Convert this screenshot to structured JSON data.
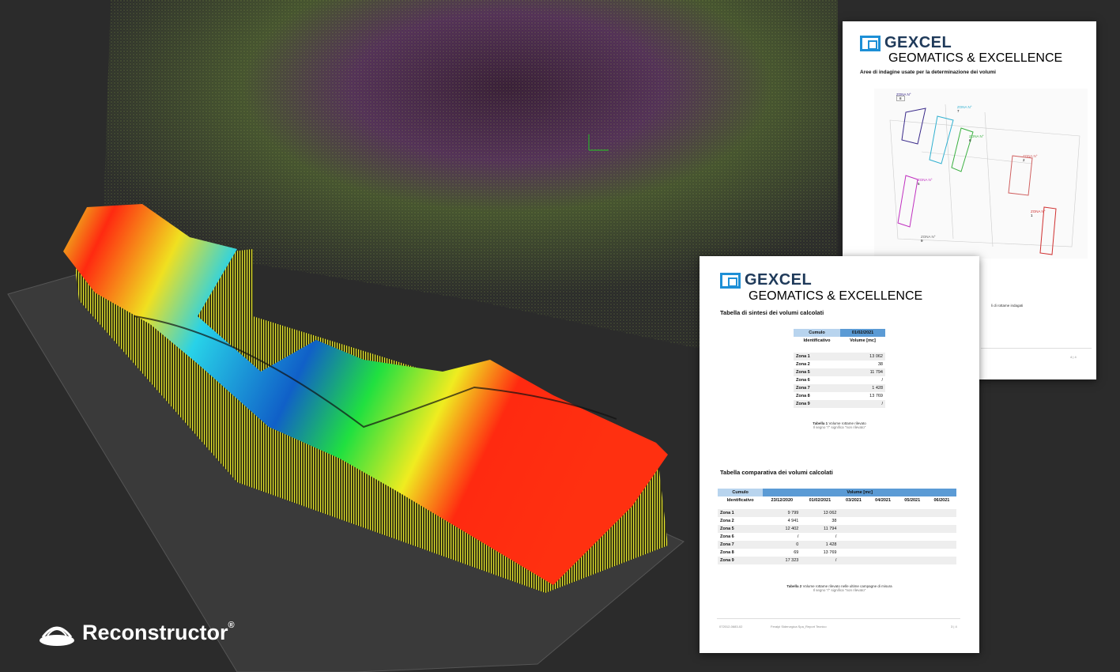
{
  "brand": {
    "name": "Reconstructor",
    "reg": "®"
  },
  "doc_back": {
    "logo": "GEXCEL",
    "logo_sub": "GEOMATICS & EXCELLENCE",
    "title": "Aree di indagine usate per la determinazione dei volumi",
    "zones": [
      {
        "label": "ZONA N°",
        "num": "8"
      },
      {
        "label": "ZONA N°",
        "num": "7"
      },
      {
        "label": "ZONA N°",
        "num": "6"
      },
      {
        "label": "ZONA N°",
        "num": "2"
      },
      {
        "label": "ZONA N°",
        "num": "5"
      },
      {
        "label": "ZONA N°",
        "num": "1"
      },
      {
        "label": "ZONA N°",
        "num": "9"
      }
    ],
    "caption": "li di rottame indagati",
    "page": "4 | 4"
  },
  "doc_front": {
    "logo": "GEXCEL",
    "logo_sub": "GEOMATICS & EXCELLENCE",
    "t1_title": "Tabella di sintesi dei volumi calcolati",
    "t1": {
      "h_cumulo": "Cumulo",
      "h_date": "01/02/2021",
      "h_ident": "Identificativo",
      "h_vol": "Volume [mc]",
      "rows": [
        {
          "zona": "Zona 1",
          "val": "13 062"
        },
        {
          "zona": "Zona 2",
          "val": "38"
        },
        {
          "zona": "Zona 5",
          "val": "11 794"
        },
        {
          "zona": "Zona 6",
          "val": "/"
        },
        {
          "zona": "Zona 7",
          "val": "1 428"
        },
        {
          "zona": "Zona 8",
          "val": "13 769"
        },
        {
          "zona": "Zona 9",
          "val": "/"
        }
      ],
      "cap_bold": "Tabella 1",
      "cap": "Volume rottame rilevato",
      "cap2": "Il segno \"/\" significa \"non rilevato\""
    },
    "t2_title": "Tabella comparativa dei volumi calcolati",
    "t2": {
      "h_cumulo": "Cumulo",
      "h_vol": "Volume [mc]",
      "h_ident": "Identificativo",
      "dates": [
        "23/12/2020",
        "01/02/2021",
        "03/2021",
        "04/2021",
        "05/2021",
        "06/2021"
      ],
      "rows": [
        {
          "zona": "Zona 1",
          "v1": "9 799",
          "v2": "13 062"
        },
        {
          "zona": "Zona 2",
          "v1": "4 941",
          "v2": "38"
        },
        {
          "zona": "Zona 5",
          "v1": "12 402",
          "v2": "11 794"
        },
        {
          "zona": "Zona 6",
          "v1": "/",
          "v2": "/"
        },
        {
          "zona": "Zona 7",
          "v1": "0",
          "v2": "1 428"
        },
        {
          "zona": "Zona 8",
          "v1": "69",
          "v2": "13 769"
        },
        {
          "zona": "Zona 9",
          "v1": "17 323",
          "v2": "/"
        }
      ],
      "cap_bold": "Tabella 2",
      "cap": "Volume rottame rilevato nelle ultime campagne di misura",
      "cap2": "Il segno \"/\" significa \"non rilevato\""
    },
    "footer_left": "072012-0683-02",
    "footer_mid": "Feralpi Siderurgica Spa_Report Tecnico",
    "page": "3 | 4"
  }
}
